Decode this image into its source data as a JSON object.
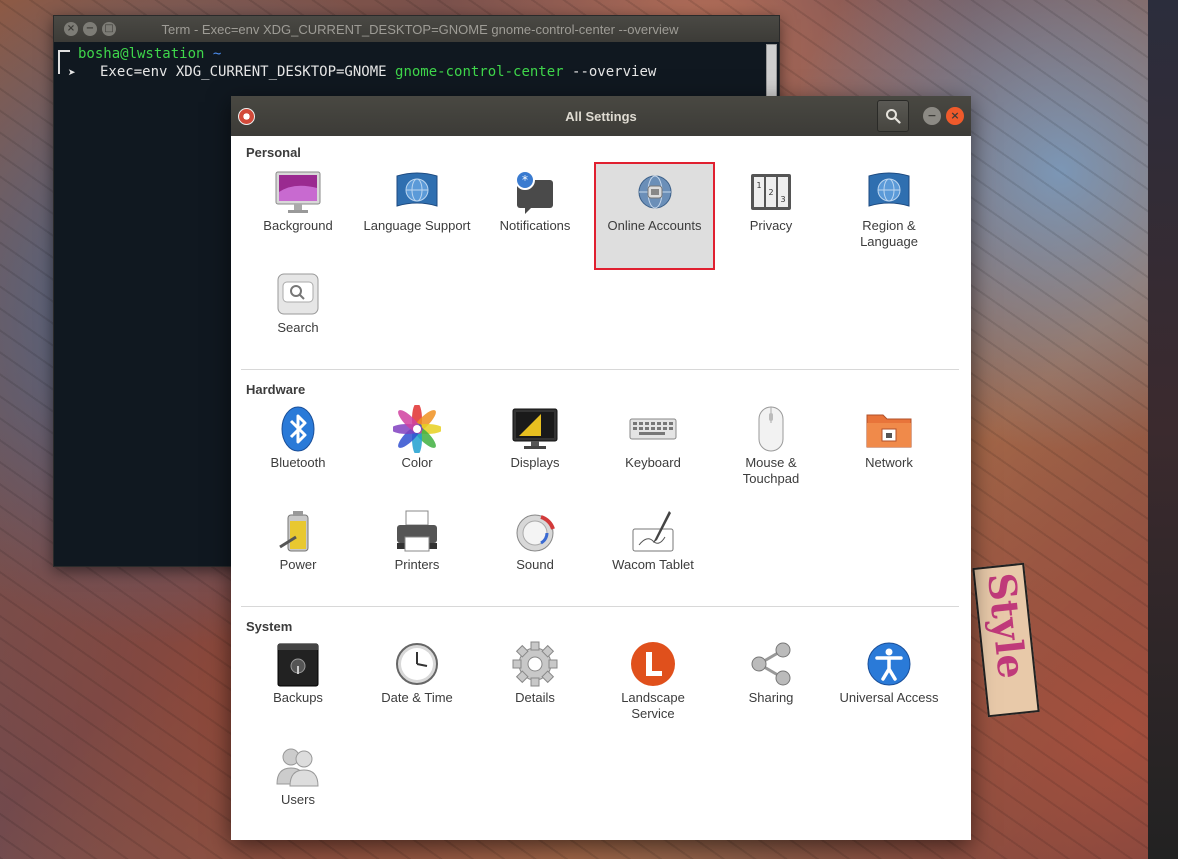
{
  "terminal": {
    "title": "Term - Exec=env XDG_CURRENT_DESKTOP=GNOME gnome-control-center --overview",
    "user_host": "bosha@lwstation",
    "cwd": "~",
    "cmd_prefix": "Exec=env XDG_CURRENT_DESKTOP=GNOME ",
    "cmd_program": "gnome-control-center",
    "cmd_args": " --overview"
  },
  "settings": {
    "title": "All Settings",
    "sections": {
      "personal": {
        "title": "Personal",
        "items": [
          {
            "label": "Background",
            "icon": "background-icon"
          },
          {
            "label": "Language Support",
            "icon": "language-support-icon"
          },
          {
            "label": "Notifications",
            "icon": "notifications-icon"
          },
          {
            "label": "Online Accounts",
            "icon": "online-accounts-icon",
            "selected": true
          },
          {
            "label": "Privacy",
            "icon": "privacy-icon"
          },
          {
            "label": "Region & Language",
            "icon": "region-language-icon"
          },
          {
            "label": "Search",
            "icon": "search-settings-icon"
          }
        ]
      },
      "hardware": {
        "title": "Hardware",
        "items": [
          {
            "label": "Bluetooth",
            "icon": "bluetooth-icon"
          },
          {
            "label": "Color",
            "icon": "color-icon"
          },
          {
            "label": "Displays",
            "icon": "displays-icon"
          },
          {
            "label": "Keyboard",
            "icon": "keyboard-icon"
          },
          {
            "label": "Mouse & Touchpad",
            "icon": "mouse-icon"
          },
          {
            "label": "Network",
            "icon": "network-icon"
          },
          {
            "label": "Power",
            "icon": "power-icon"
          },
          {
            "label": "Printers",
            "icon": "printers-icon"
          },
          {
            "label": "Sound",
            "icon": "sound-icon"
          },
          {
            "label": "Wacom Tablet",
            "icon": "wacom-tablet-icon"
          }
        ]
      },
      "system": {
        "title": "System",
        "items": [
          {
            "label": "Backups",
            "icon": "backups-icon"
          },
          {
            "label": "Date & Time",
            "icon": "date-time-icon"
          },
          {
            "label": "Details",
            "icon": "details-icon"
          },
          {
            "label": "Landscape Service",
            "icon": "landscape-service-icon"
          },
          {
            "label": "Sharing",
            "icon": "sharing-icon"
          },
          {
            "label": "Universal Access",
            "icon": "universal-access-icon"
          },
          {
            "label": "Users",
            "icon": "users-icon"
          }
        ]
      }
    }
  },
  "colors": {
    "accent_selected_border": "#e02030",
    "header_bg": "#3c3b37",
    "terminal_green": "#3fd64b",
    "terminal_blue": "#4c8ef0"
  }
}
